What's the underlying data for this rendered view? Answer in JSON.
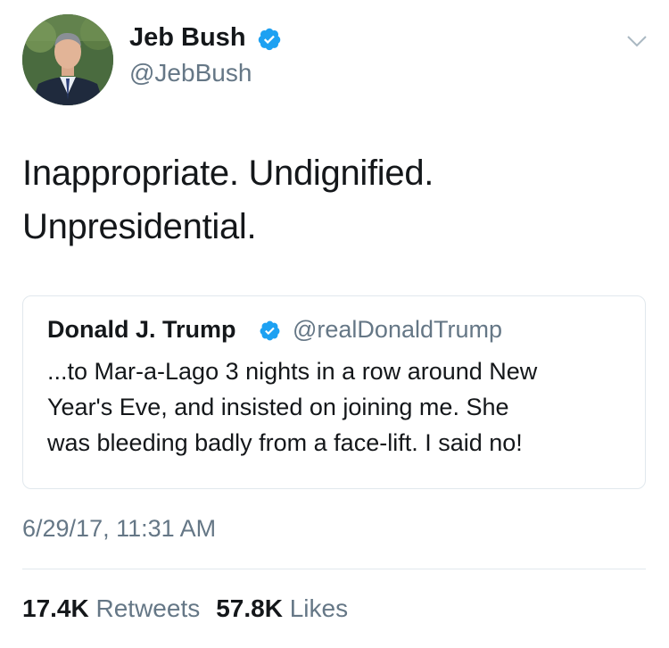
{
  "author": {
    "name": "Jeb Bush",
    "handle": "@JebBush",
    "verified_icon": "verified-badge-icon"
  },
  "tweet": {
    "text_line1": "Inappropriate. Undignified.",
    "text_line2": "Unpresidential."
  },
  "quoted_tweet": {
    "name": "Donald J. Trump",
    "handle": "@realDonaldTrump",
    "verified_icon": "verified-badge-icon",
    "text_line1": "...to Mar-a-Lago 3 nights in a row around New",
    "text_line2": "Year's Eve, and insisted on joining me. She",
    "text_line3": "was bleeding badly from a face-lift. I said no!"
  },
  "timestamp": "6/29/17, 11:31 AM",
  "stats": {
    "retweets_count": "17.4K",
    "retweets_label": "Retweets",
    "likes_count": "57.8K",
    "likes_label": "Likes"
  },
  "colors": {
    "text": "#14171a",
    "secondary_text": "#657786",
    "verified_blue": "#1da1f2",
    "border": "#e1e8ed"
  }
}
